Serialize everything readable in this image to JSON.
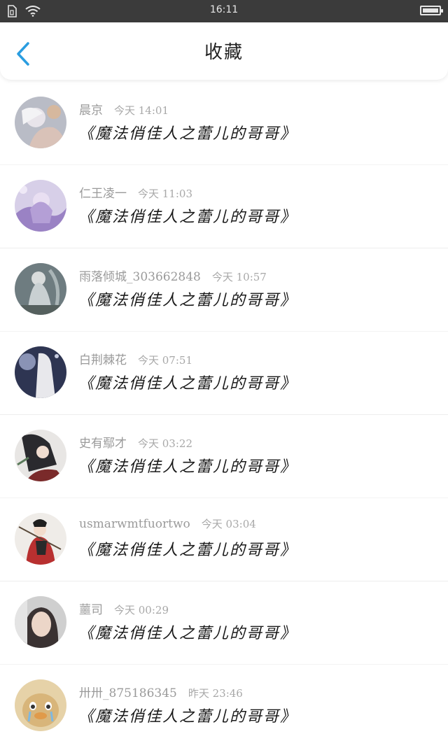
{
  "status_bar": {
    "time": "16:11"
  },
  "header": {
    "title": "收藏"
  },
  "items": [
    {
      "user": "晨京",
      "time": "今天 14:01",
      "book": "《魔法俏佳人之蕾儿的哥哥》"
    },
    {
      "user": "仁王凌一",
      "time": "今天 11:03",
      "book": "《魔法俏佳人之蕾儿的哥哥》"
    },
    {
      "user": "雨落倾城_303662848",
      "time": "今天 10:57",
      "book": "《魔法俏佳人之蕾儿的哥哥》"
    },
    {
      "user": "白荆棘花",
      "time": "今天 07:51",
      "book": "《魔法俏佳人之蕾儿的哥哥》"
    },
    {
      "user": "史有鄢才",
      "time": "今天 03:22",
      "book": "《魔法俏佳人之蕾儿的哥哥》"
    },
    {
      "user": "usmarwmtfuortwo",
      "time": "今天 03:04",
      "book": "《魔法俏佳人之蕾儿的哥哥》"
    },
    {
      "user": "蘁司",
      "time": "今天 00:29",
      "book": "《魔法俏佳人之蕾儿的哥哥》"
    },
    {
      "user": "卅卅_875186345",
      "time": "昨天 23:46",
      "book": "《魔法俏佳人之蕾儿的哥哥》"
    }
  ],
  "colors": {
    "accent": "#2a9de0",
    "statusbar": "#3b3b3b"
  }
}
